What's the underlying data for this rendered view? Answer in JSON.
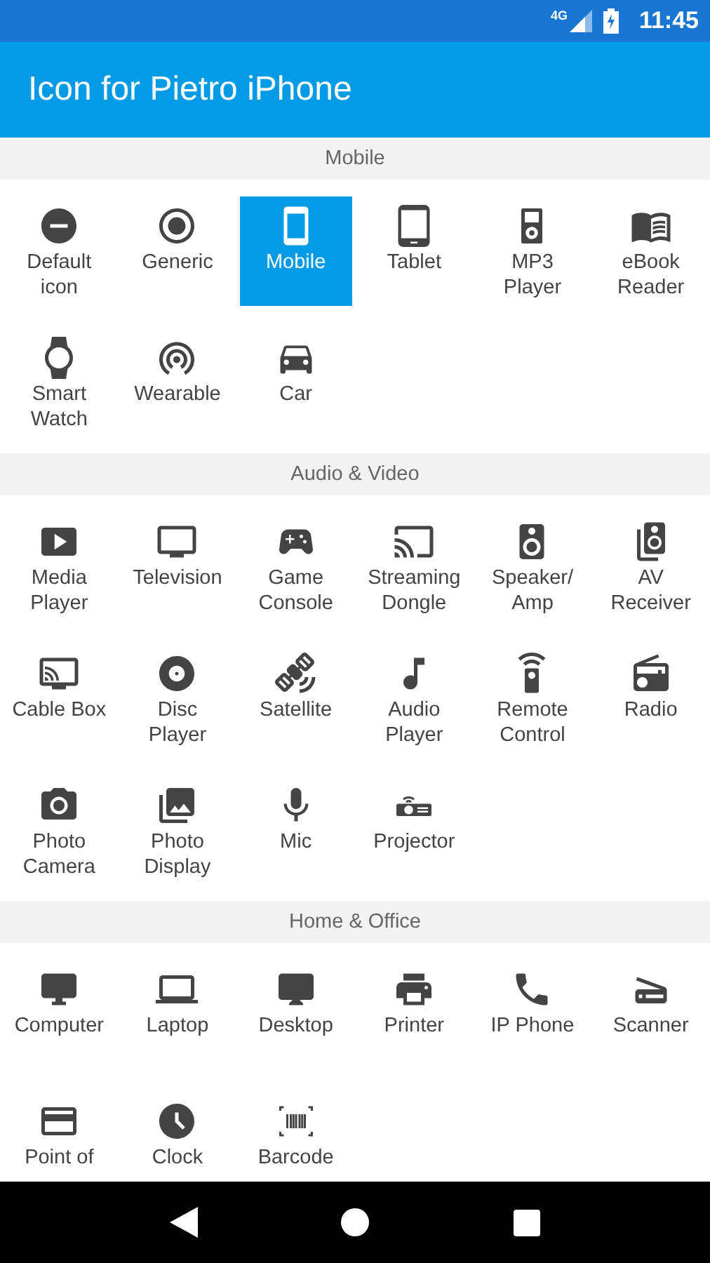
{
  "status_bar": {
    "network": "4G",
    "time": "11:45"
  },
  "app_bar": {
    "title": "Icon for Pietro iPhone"
  },
  "sections": [
    {
      "title": "Mobile",
      "items": [
        {
          "label": "Default icon",
          "selected": false
        },
        {
          "label": "Generic",
          "selected": false
        },
        {
          "label": "Mobile",
          "selected": true
        },
        {
          "label": "Tablet",
          "selected": false
        },
        {
          "label": "MP3 Player",
          "selected": false
        },
        {
          "label": "eBook Reader",
          "selected": false
        },
        {
          "label": "Smart Watch",
          "selected": false
        },
        {
          "label": "Wearable",
          "selected": false
        },
        {
          "label": "Car",
          "selected": false
        }
      ]
    },
    {
      "title": "Audio & Video",
      "items": [
        {
          "label": "Media Player",
          "selected": false
        },
        {
          "label": "Television",
          "selected": false
        },
        {
          "label": "Game Console",
          "selected": false
        },
        {
          "label": "Streaming Dongle",
          "selected": false
        },
        {
          "label": "Speaker/ Amp",
          "selected": false
        },
        {
          "label": "AV Receiver",
          "selected": false
        },
        {
          "label": "Cable Box",
          "selected": false
        },
        {
          "label": "Disc Player",
          "selected": false
        },
        {
          "label": "Satellite",
          "selected": false
        },
        {
          "label": "Audio Player",
          "selected": false
        },
        {
          "label": "Remote Control",
          "selected": false
        },
        {
          "label": "Radio",
          "selected": false
        },
        {
          "label": "Photo Camera",
          "selected": false
        },
        {
          "label": "Photo Display",
          "selected": false
        },
        {
          "label": "Mic",
          "selected": false
        },
        {
          "label": "Projector",
          "selected": false
        }
      ]
    },
    {
      "title": "Home & Office",
      "items": [
        {
          "label": "Computer",
          "selected": false
        },
        {
          "label": "Laptop",
          "selected": false
        },
        {
          "label": "Desktop",
          "selected": false
        },
        {
          "label": "Printer",
          "selected": false
        },
        {
          "label": "IP Phone",
          "selected": false
        },
        {
          "label": "Scanner",
          "selected": false
        },
        {
          "label": "Point of",
          "selected": false
        },
        {
          "label": "Clock",
          "selected": false
        },
        {
          "label": "Barcode",
          "selected": false
        }
      ]
    }
  ]
}
